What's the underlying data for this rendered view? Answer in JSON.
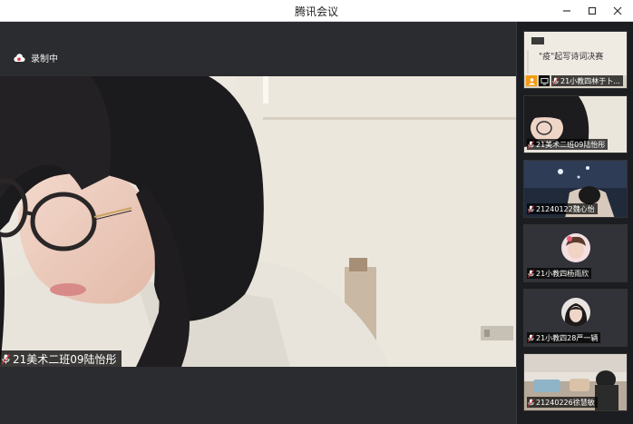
{
  "window": {
    "title": "腾讯会议"
  },
  "recording": {
    "label": "录制中"
  },
  "main_video": {
    "participant": "21美术二班09陆怡彤"
  },
  "sidebar": {
    "tiles": [
      {
        "name": "21小教四林于卜...",
        "slide_text": "\"疫\"起写诗词决赛"
      },
      {
        "name": "21美术二班09陆怡彤"
      },
      {
        "name": "21240122魏心怡"
      },
      {
        "name": "21小教四杨雨欣"
      },
      {
        "name": "21小教四28严一辆"
      },
      {
        "name": "21240226徐慧敏"
      }
    ]
  },
  "colors": {
    "accent_orange": "#f39c12",
    "recording_red": "#e03c3c"
  }
}
